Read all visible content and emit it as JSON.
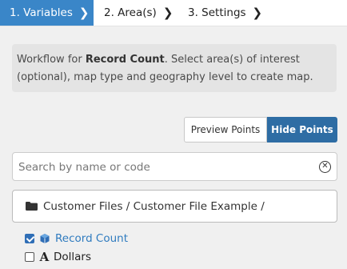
{
  "steps": [
    {
      "label": "1. Variables",
      "active": true
    },
    {
      "label": "2. Area(s)",
      "active": false
    },
    {
      "label": "3. Settings",
      "active": false
    }
  ],
  "info": {
    "prefix": "Workflow for ",
    "bold": "Record Count",
    "suffix": ". Select area(s) of interest (optional), map type and geography level to create map."
  },
  "buttons": {
    "preview_points": "Preview Points",
    "hide_points": "Hide Points"
  },
  "search": {
    "placeholder": "Search by name or code",
    "value": ""
  },
  "breadcrumb": "Customer Files / Customer File Example /",
  "variables": [
    {
      "label": "Record Count",
      "checked": true,
      "icon": "cube-icon"
    },
    {
      "label": "Dollars",
      "checked": false,
      "icon": "text-type-icon"
    }
  ],
  "colors": {
    "accent": "#3a86c8",
    "primary_button": "#2e6da4",
    "link": "#2f7bbf"
  }
}
